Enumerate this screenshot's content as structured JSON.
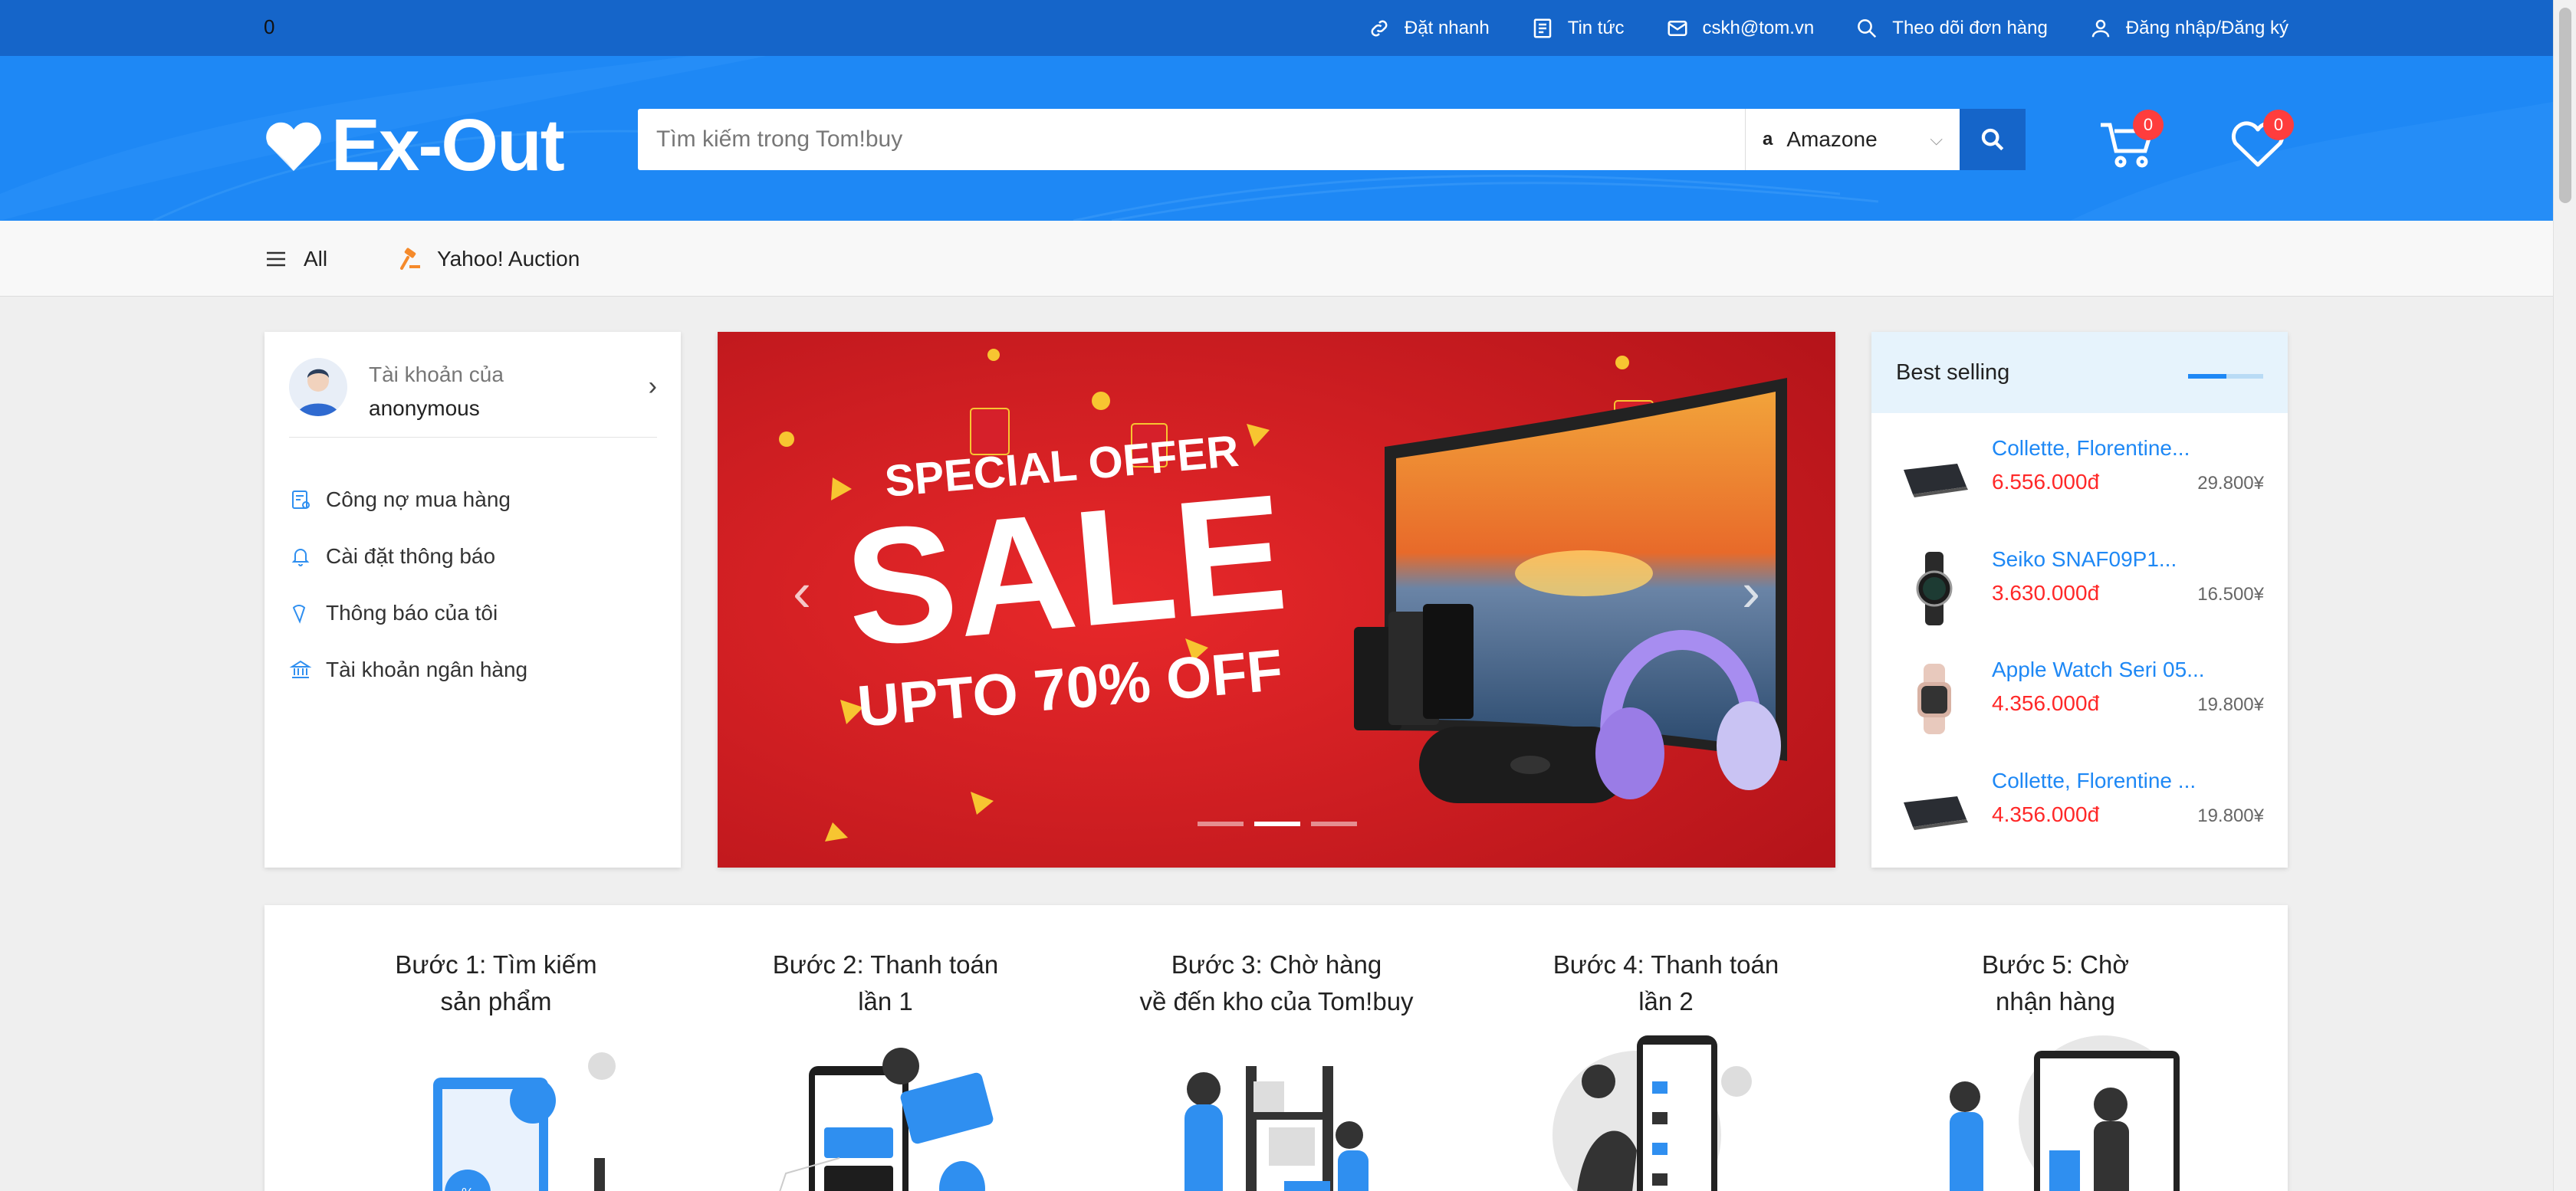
{
  "topbar": {
    "counter": "0",
    "links": [
      {
        "label": "Đặt nhanh",
        "icon": "link-icon"
      },
      {
        "label": "Tin tức",
        "icon": "news-icon"
      },
      {
        "label": "cskh@tom.vn",
        "icon": "mail-icon"
      },
      {
        "label": "Theo dõi đơn hàng",
        "icon": "search-icon"
      },
      {
        "label": "Đăng nhập/Đăng ký",
        "icon": "user-icon"
      }
    ]
  },
  "header": {
    "logo_text": "Ex-Out",
    "search_placeholder": "Tìm kiếm trong Tom!buy",
    "store": {
      "icon_letter": "a",
      "selected": "Amazone"
    },
    "cart_count": "0",
    "wishlist_count": "0"
  },
  "categories": [
    {
      "label": "All",
      "icon": "hamburger-menu-icon"
    },
    {
      "label": "Yahoo! Auction",
      "icon": "auction-hammer-icon"
    }
  ],
  "account": {
    "line1": "Tài khoản của",
    "line2": "anonymous",
    "menu": [
      {
        "label": "Công nợ mua hàng",
        "icon": "debt-icon"
      },
      {
        "label": "Cài đặt thông báo",
        "icon": "bell-icon"
      },
      {
        "label": "Thông báo của tôi",
        "icon": "notification-icon"
      },
      {
        "label": "Tài khoản ngân hàng",
        "icon": "bank-icon"
      }
    ]
  },
  "banner": {
    "line1": "SPECIAL OFFER",
    "line2": "SALE",
    "line3": "UPTO 70% OFF",
    "active_slide": 2,
    "slide_count": 3
  },
  "best_selling": {
    "title": "Best selling",
    "items": [
      {
        "name": "Collette, Florentine...",
        "price": "6.556.000đ",
        "yen": "29.800¥",
        "thumb": "laptop"
      },
      {
        "name": "Seiko SNAF09P1...",
        "price": "3.630.000đ",
        "yen": "16.500¥",
        "thumb": "watch"
      },
      {
        "name": "Apple Watch Seri 05...",
        "price": "4.356.000đ",
        "yen": "19.800¥",
        "thumb": "smartwatch"
      },
      {
        "name": "Collette, Florentine ...",
        "price": "4.356.000đ",
        "yen": "19.800¥",
        "thumb": "laptop"
      }
    ]
  },
  "steps": [
    {
      "line1": "Bước 1: Tìm kiếm",
      "line2": "sản phẩm"
    },
    {
      "line1": "Bước 2: Thanh toán",
      "line2": "lần 1"
    },
    {
      "line1": "Bước 3: Chờ hàng",
      "line2": "về đến kho của Tom!buy"
    },
    {
      "line1": "Bước 4: Thanh toán",
      "line2": "lần 2"
    },
    {
      "line1": "Bước 5: Chờ",
      "line2": "nhận hàng"
    }
  ],
  "colors": {
    "primary": "#1565c9",
    "header": "#1e88f5",
    "price": "#ff2828",
    "badge": "#ff3d3d"
  }
}
